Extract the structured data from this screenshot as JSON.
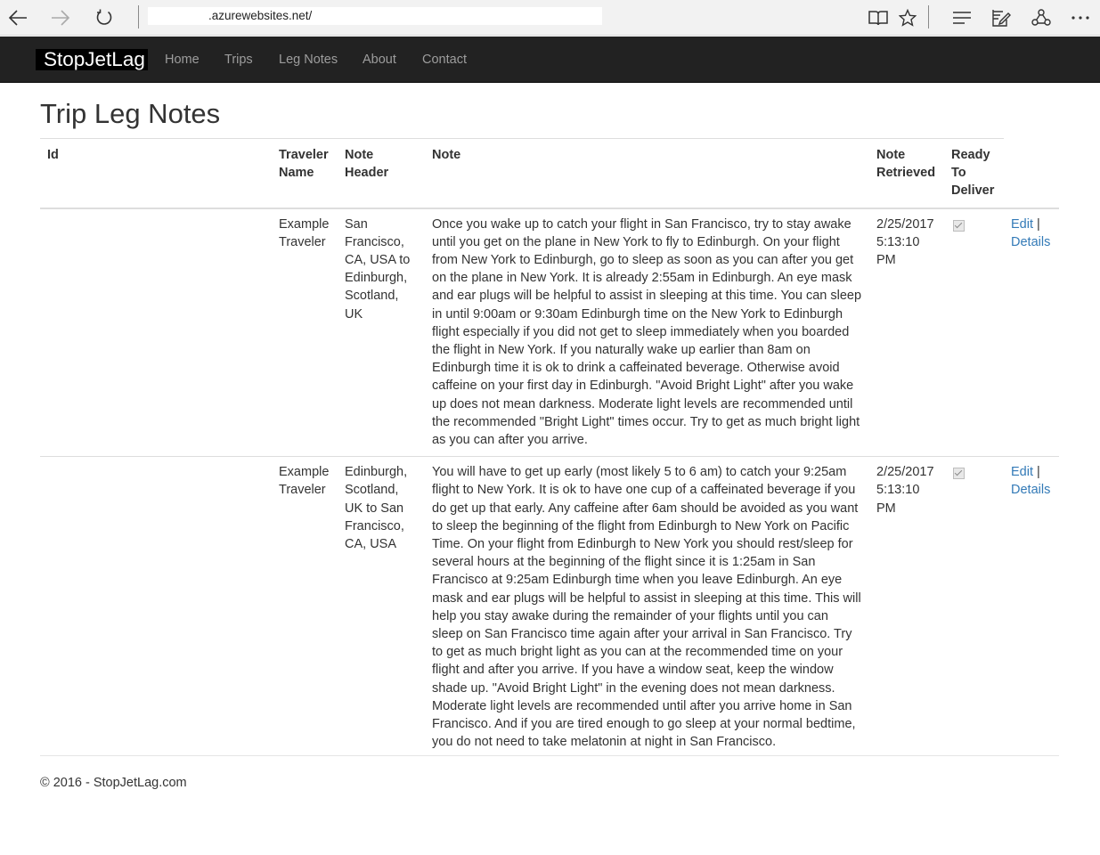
{
  "browser": {
    "url_domain": ".azurewebsites.net/",
    "back_icon": "back-arrow-icon",
    "forward_icon": "forward-arrow-icon",
    "refresh_icon": "refresh-icon",
    "reading_view_icon": "book-icon",
    "favorite_icon": "star-icon",
    "hub_icon": "hub-lines-icon",
    "web_note_icon": "pen-note-icon",
    "share_icon": "share-icon",
    "more_icon": "more-dots-icon"
  },
  "navbar": {
    "brand": "StopJetLag",
    "links": [
      "Home",
      "Trips",
      "Leg Notes",
      "About",
      "Contact"
    ]
  },
  "page": {
    "title": "Trip Leg Notes"
  },
  "table": {
    "headers": {
      "id": "Id",
      "traveler_name_1": "Traveler",
      "traveler_name_2": "Name",
      "note_header_1": "Note",
      "note_header_2": "Header",
      "note": "Note",
      "note_retrieved_1": "Note",
      "note_retrieved_2": "Retrieved",
      "ready_1": "Ready",
      "ready_2": "To",
      "ready_3": "Deliver"
    },
    "rows": [
      {
        "id": "",
        "traveler": "Example Traveler",
        "header": "San Francisco, CA, USA to Edinburgh, Scotland, UK",
        "note": "Once you wake up to catch your flight in San Francisco, try to stay awake until you get on the plane in New York to fly to Edinburgh. On your flight from New York to Edinburgh, go to sleep as soon as you can after you get on the plane in New York. It is already 2:55am in Edinburgh. An eye mask and ear plugs will be helpful to assist in sleeping at this time. You can sleep in until 9:00am or 9:30am Edinburgh time on the New York to Edinburgh flight especially if you did not get to sleep immediately when you boarded the flight in New York. If you naturally wake up earlier than 8am on Edinburgh time it is ok to drink a caffeinated beverage. Otherwise avoid caffeine on your first day in Edinburgh. \"Avoid Bright Light\" after you wake up does not mean darkness. Moderate light levels are recommended until the recommended \"Bright Light\" times occur. Try to get as much bright light as you can after you arrive.",
        "retrieved": "2/25/2017 5:13:10 PM",
        "ready": true,
        "edit": "Edit",
        "separator": "|",
        "details": "Details"
      },
      {
        "id": "",
        "traveler": "Example Traveler",
        "header": "Edinburgh, Scotland, UK to San Francisco, CA, USA",
        "note": "You will have to get up early (most likely 5 to 6 am) to catch your 9:25am flight to New York. It is ok to have one cup of a caffeinated beverage if you do get up that early. Any caffeine after 6am should be avoided as you want to sleep the beginning of the flight from Edinburgh to New York on Pacific Time. On your flight from Edinburgh to New York you should rest/sleep for several hours at the beginning of the flight since it is 1:25am in San Francisco at 9:25am Edinburgh time when you leave Edinburgh. An eye mask and ear plugs will be helpful to assist in sleeping at this time. This will help you stay awake during the remainder of your flights until you can sleep on San Francisco time again after your arrival in San Francisco. Try to get as much bright light as you can at the recommended time on your flight and after you arrive. If you have a window seat, keep the window shade up. \"Avoid Bright Light\" in the evening does not mean darkness. Moderate light levels are recommended until after you arrive home in San Francisco. And if you are tired enough to go sleep at your normal bedtime, you do not need to take melatonin at night in San Francisco.",
        "retrieved": "2/25/2017 5:13:10 PM",
        "ready": true,
        "edit": "Edit",
        "separator": "|",
        "details": "Details"
      }
    ]
  },
  "footer": {
    "text": "© 2016 - StopJetLag.com"
  }
}
